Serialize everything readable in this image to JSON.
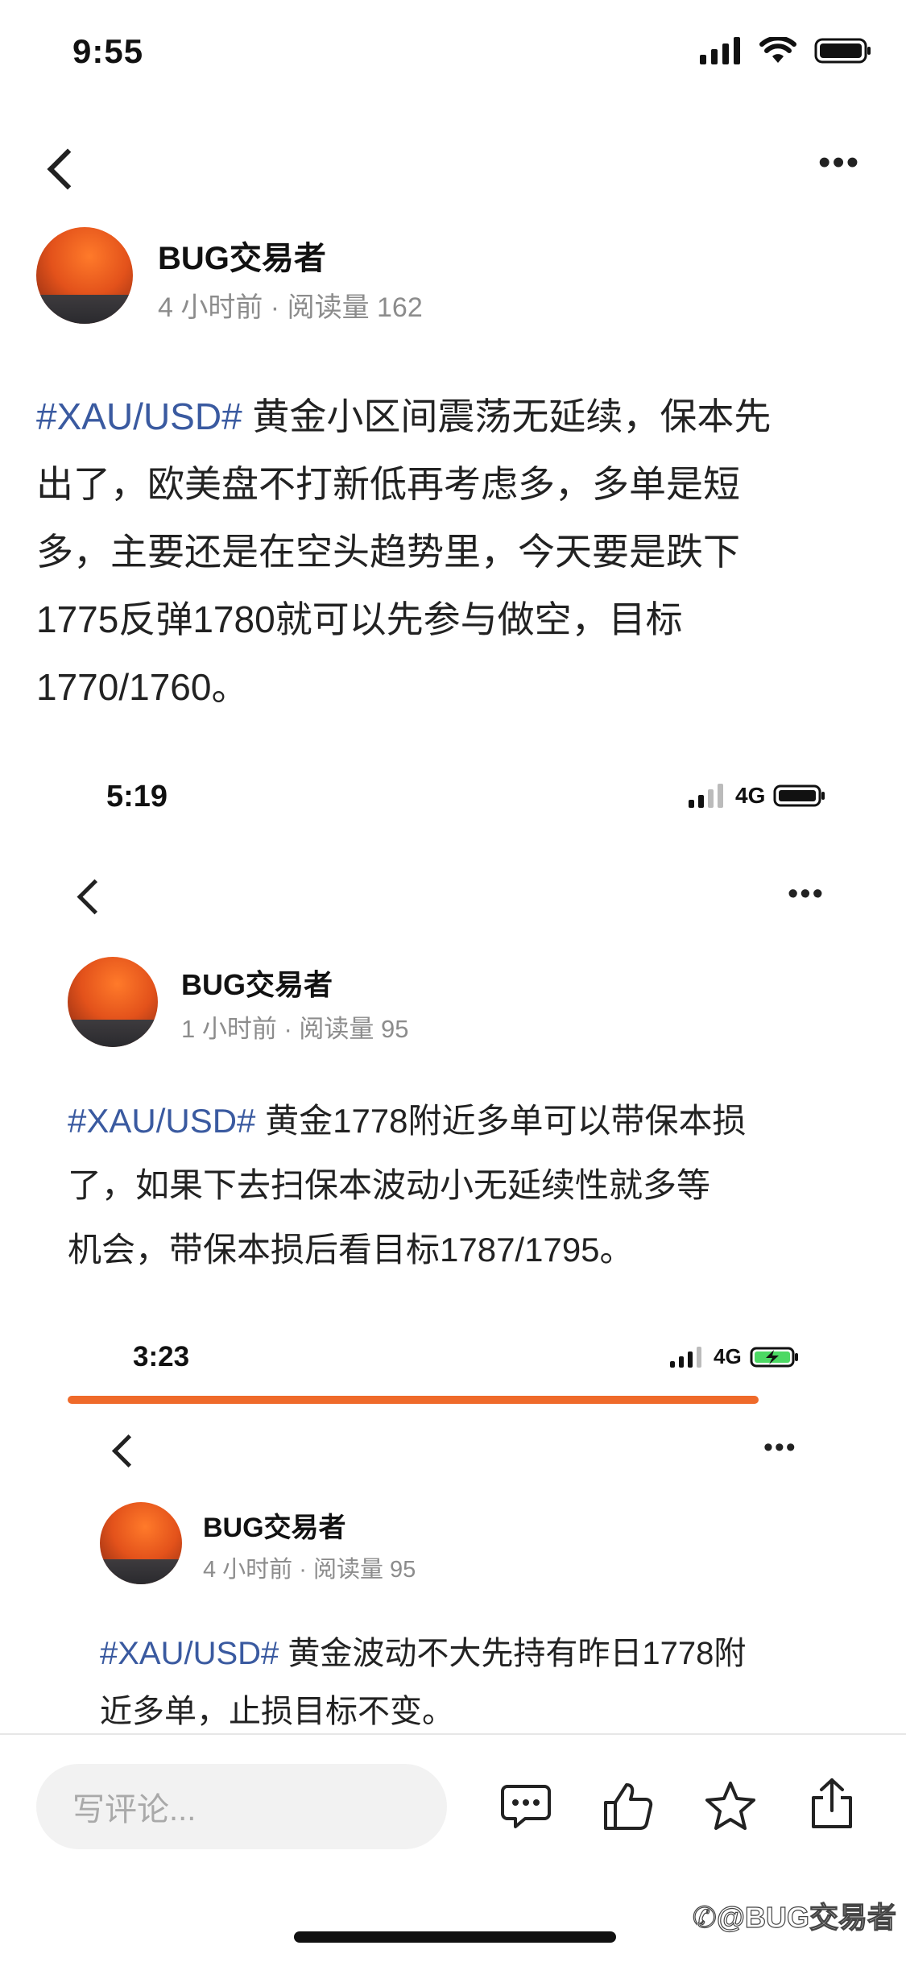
{
  "status_bar": {
    "time": "9:55"
  },
  "post1": {
    "author": "BUG交易者",
    "meta": "4 小时前 · 阅读量 162",
    "tag": "#XAU/USD#",
    "lines": [
      " 黄金小区间震荡无延续，保本先",
      "出了，欧美盘不打新低再考虑多，多单是短",
      "多，主要还是在空头趋势里，今天要是跌下",
      "1775反弹1780就可以先参与做空，目标",
      "1770/1760。"
    ]
  },
  "screenshot2": {
    "time": "5:19",
    "network": "4G",
    "author": "BUG交易者",
    "meta": "1 小时前 · 阅读量 95",
    "tag": "#XAU/USD#",
    "lines": [
      " 黄金1778附近多单可以带保本损",
      "了，如果下去扫保本波动小无延续性就多等",
      "机会，带保本损后看目标1787/1795。"
    ]
  },
  "screenshot3": {
    "time": "3:23",
    "network": "4G",
    "author": "BUG交易者",
    "meta": "4 小时前 · 阅读量 95",
    "tag": "#XAU/USD#",
    "lines": [
      " 黄金波动不大先持有昨日1778附",
      "近多单，止损目标不变。"
    ]
  },
  "bottom_bar": {
    "comment_placeholder": "写评论...",
    "icons": [
      "comment-icon",
      "like-icon",
      "star-icon",
      "share-icon"
    ]
  },
  "watermark": "@BUG交易者",
  "colors": {
    "tag": "#3a5aa0",
    "accent": "#ef6a2a",
    "meta": "#8c8c8c"
  }
}
